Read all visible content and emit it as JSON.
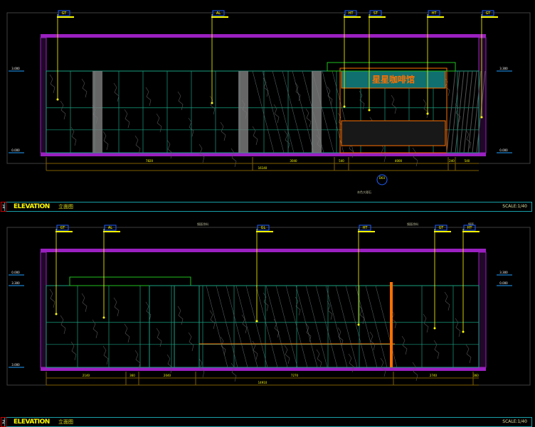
{
  "colors": {
    "beam": "#9a20c0",
    "wall": "#18a080",
    "tag": "#ffff00",
    "tag_box": "#2060ff",
    "dim": "#806000",
    "frame": "#404040",
    "sign": "#ff7000",
    "sign_bg": "#107070"
  },
  "elevations": [
    {
      "number": "1",
      "title": "ELEVATION",
      "subtitle": "立面图",
      "scale": "SCALE:1/40",
      "tags": [
        "GT",
        "AL",
        "HT",
        "ST",
        "HT",
        "GT"
      ],
      "levels": [
        "3.000",
        "0.000",
        "3.300",
        "0.000"
      ],
      "dims": [
        "7820",
        "3040",
        "540",
        "4000",
        "240",
        "540"
      ],
      "total": "16140",
      "sign_text": "星星咖啡馆",
      "section_mark": "D03",
      "material_note": "灰色大理石"
    },
    {
      "number": "2",
      "title": "ELEVATION",
      "subtitle": "立面图",
      "scale": "SCALE:1/40",
      "tags": [
        "GT",
        "AL",
        "GL",
        "HT",
        "GT",
        "HT"
      ],
      "levels": [
        "3.300",
        "3.000",
        "0.000",
        "3.300",
        "0.000"
      ],
      "dims": [
        "2140",
        "360",
        "2040",
        "7270",
        "2740",
        "360"
      ],
      "total": "14910",
      "notes": [
        "镜面涂料",
        "镜面涂料",
        "镜面"
      ]
    }
  ]
}
